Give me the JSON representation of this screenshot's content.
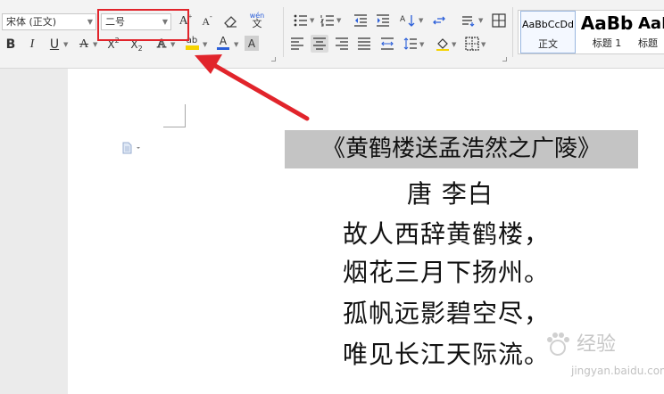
{
  "ribbon": {
    "font_name": "宋体 (正文)",
    "font_size": "二号",
    "font_size_options": [
      "二号"
    ],
    "icons": [
      "grow-font-icon",
      "shrink-font-icon",
      "clear-format-icon",
      "phonetic-guide-icon",
      "bullets-icon",
      "numbering-icon",
      "decrease-indent-icon",
      "increase-indent-icon",
      "sort-icon",
      "show-hide-marks-icon",
      "line-spacing-direction-icon",
      "table-icon",
      "bold-icon",
      "italic-icon",
      "underline-icon",
      "strikethrough-icon",
      "superscript-icon",
      "subscript-icon",
      "text-effect-icon",
      "highlight-icon",
      "font-color-icon",
      "char-shading-icon",
      "align-left-icon",
      "align-center-icon",
      "align-right-icon",
      "justify-icon",
      "distributed-icon",
      "line-spacing-icon",
      "shading-icon",
      "borders-icon"
    ],
    "letters": {
      "grow_font": "A",
      "shrink_font": "A",
      "phonetic": "wén",
      "bold": "B",
      "italic": "I",
      "underline": "U",
      "strike": "A",
      "superscript": "X",
      "subscript": "X",
      "sup_mark": "2",
      "sub_mark": "2",
      "text_effect": "A",
      "highlight": "ab",
      "font_color": "A",
      "char_shading": "A"
    },
    "styles": [
      {
        "preview": "AaBbCcDd",
        "name": "正文"
      },
      {
        "preview": "AaBb",
        "name": "标题 1"
      },
      {
        "preview": "AaI",
        "name": "标题"
      }
    ]
  },
  "colors": {
    "annotation_red": "#e1242b",
    "highlight_yellow": "#f5d300",
    "font_color_blue": "#2b5fd9",
    "title_bg": "#c4c4c4"
  },
  "document": {
    "title": "《黄鹤楼送孟浩然之广陵》",
    "author": "唐 李白",
    "lines": [
      "故人西辞黄鹤楼，",
      "烟花三月下扬州。",
      "孤帆远影碧空尽，",
      "唯见长江天际流。"
    ]
  },
  "watermark": {
    "text": "经验",
    "url": "jingyan.baidu.com"
  }
}
